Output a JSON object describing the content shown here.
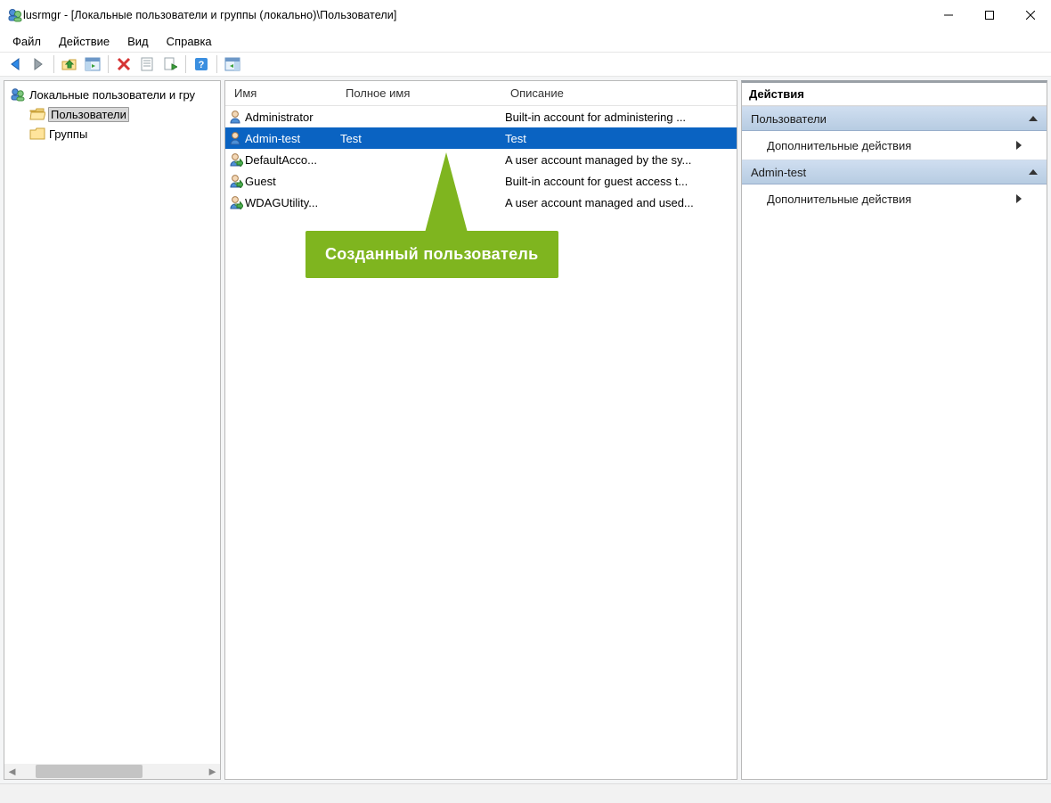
{
  "titlebar": {
    "title": "lusrmgr - [Локальные пользователи и группы (локально)\\Пользователи]"
  },
  "menubar": {
    "items": [
      "Файл",
      "Действие",
      "Вид",
      "Справка"
    ]
  },
  "toolbar": {
    "icons": [
      "back",
      "forward",
      "up",
      "show-hide",
      "delete",
      "properties",
      "export",
      "help",
      "tile"
    ]
  },
  "tree": {
    "root": "Локальные пользователи и гру",
    "children": [
      {
        "label": "Пользователи",
        "selected": true,
        "icon": "folder-open"
      },
      {
        "label": "Группы",
        "selected": false,
        "icon": "folder"
      }
    ]
  },
  "list": {
    "columns": {
      "name": "Имя",
      "full": "Полное имя",
      "desc": "Описание"
    },
    "rows": [
      {
        "name": "Administrator",
        "full": "",
        "desc": "Built-in account for administering ...",
        "selected": false,
        "arrow": false
      },
      {
        "name": "Admin-test",
        "full": "Test",
        "desc": "Test",
        "selected": true,
        "arrow": false
      },
      {
        "name": "DefaultAcco...",
        "full": "",
        "desc": "A user account managed by the sy...",
        "selected": false,
        "arrow": true
      },
      {
        "name": "Guest",
        "full": "",
        "desc": "Built-in account for guest access t...",
        "selected": false,
        "arrow": true
      },
      {
        "name": "WDAGUtility...",
        "full": "",
        "desc": "A user account managed and used...",
        "selected": false,
        "arrow": true
      }
    ]
  },
  "actions": {
    "title": "Действия",
    "sections": [
      {
        "header": "Пользователи",
        "items": [
          "Дополнительные действия"
        ]
      },
      {
        "header": "Admin-test",
        "items": [
          "Дополнительные действия"
        ]
      }
    ]
  },
  "annotation": {
    "text": "Созданный пользователь"
  }
}
